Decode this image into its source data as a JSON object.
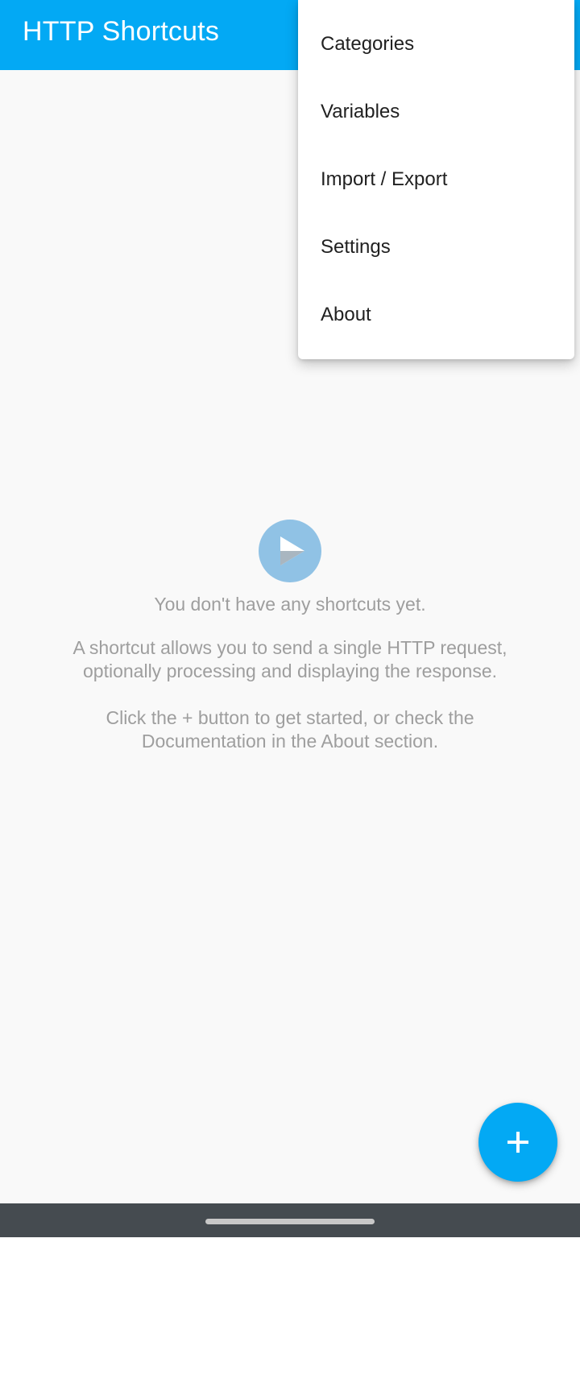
{
  "app_bar": {
    "title": "HTTP Shortcuts",
    "color": "#03a9f4"
  },
  "overflow_menu": {
    "items": [
      {
        "label": "Categories"
      },
      {
        "label": "Variables"
      },
      {
        "label": "Import / Export"
      },
      {
        "label": "Settings"
      },
      {
        "label": "About"
      }
    ]
  },
  "empty_state": {
    "icon": "play-icon",
    "line1": "You don't have any shortcuts yet.",
    "line2a": "A shortcut allows you to send a single HTTP request,",
    "line2b": "optionally processing and displaying the response.",
    "line3a": "Click the + button to get started, or check the",
    "line3b": "Documentation in the About section."
  },
  "fab": {
    "icon": "plus-icon",
    "color": "#03a9f4"
  },
  "navigation_bar": {
    "icon": "home-handle"
  }
}
